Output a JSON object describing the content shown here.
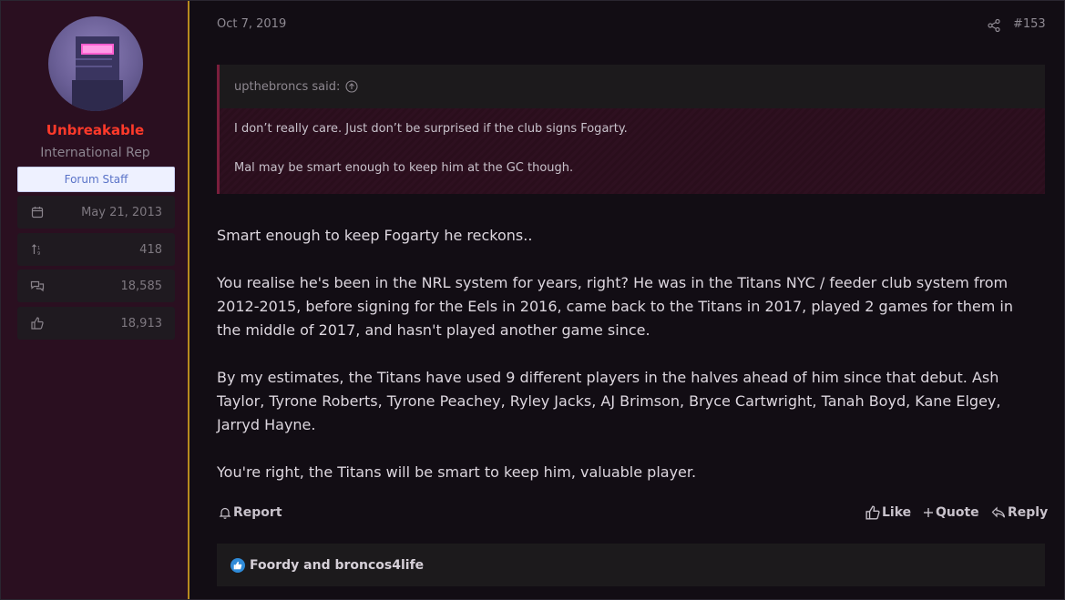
{
  "user": {
    "name": "Unbreakable",
    "title": "International Rep",
    "badge": "Forum Staff",
    "stats": [
      {
        "icon": "calendar-icon",
        "value": "May 21, 2013"
      },
      {
        "icon": "sort-icon",
        "value": "418"
      },
      {
        "icon": "messages-icon",
        "value": "18,585"
      },
      {
        "icon": "thumbs-up-icon",
        "value": "18,913"
      }
    ]
  },
  "post": {
    "date": "Oct 7, 2019",
    "number": "#153",
    "quote": {
      "author": "upthebroncs said:",
      "lines": [
        "I don’t really care. Just don’t be surprised if the club signs Fogarty.",
        "Mal may be smart enough to keep him at the GC though."
      ]
    },
    "paragraphs": [
      "Smart enough to keep Fogarty he reckons..",
      "You realise he's been in the NRL system for years, right? He was in the Titans NYC / feeder club system from 2012-2015, before signing for the Eels in 2016, came back to the Titans in 2017, played 2 games for them in the middle of 2017, and hasn't played another game since.",
      "By my estimates, the Titans have used 9 different players in the halves ahead of him since that debut. Ash Taylor, Tyrone Roberts, Tyrone Peachey, Ryley Jacks, AJ Brimson, Bryce Cartwright, Tanah Boyd, Kane Elgey, Jarryd Hayne.",
      "You're right, the Titans will be smart to keep him, valuable player."
    ],
    "actions": {
      "report": "Report",
      "like": "Like",
      "quote": "Quote",
      "reply": "Reply"
    },
    "reactions": "Foordy and broncos4life"
  },
  "colors": {
    "username": "#ff3a2a",
    "sidebar_bg": "#2a0f20",
    "divider": "#b88a1f",
    "quote_border": "#7a1e3c",
    "reaction_blue": "#2f8bd8"
  }
}
